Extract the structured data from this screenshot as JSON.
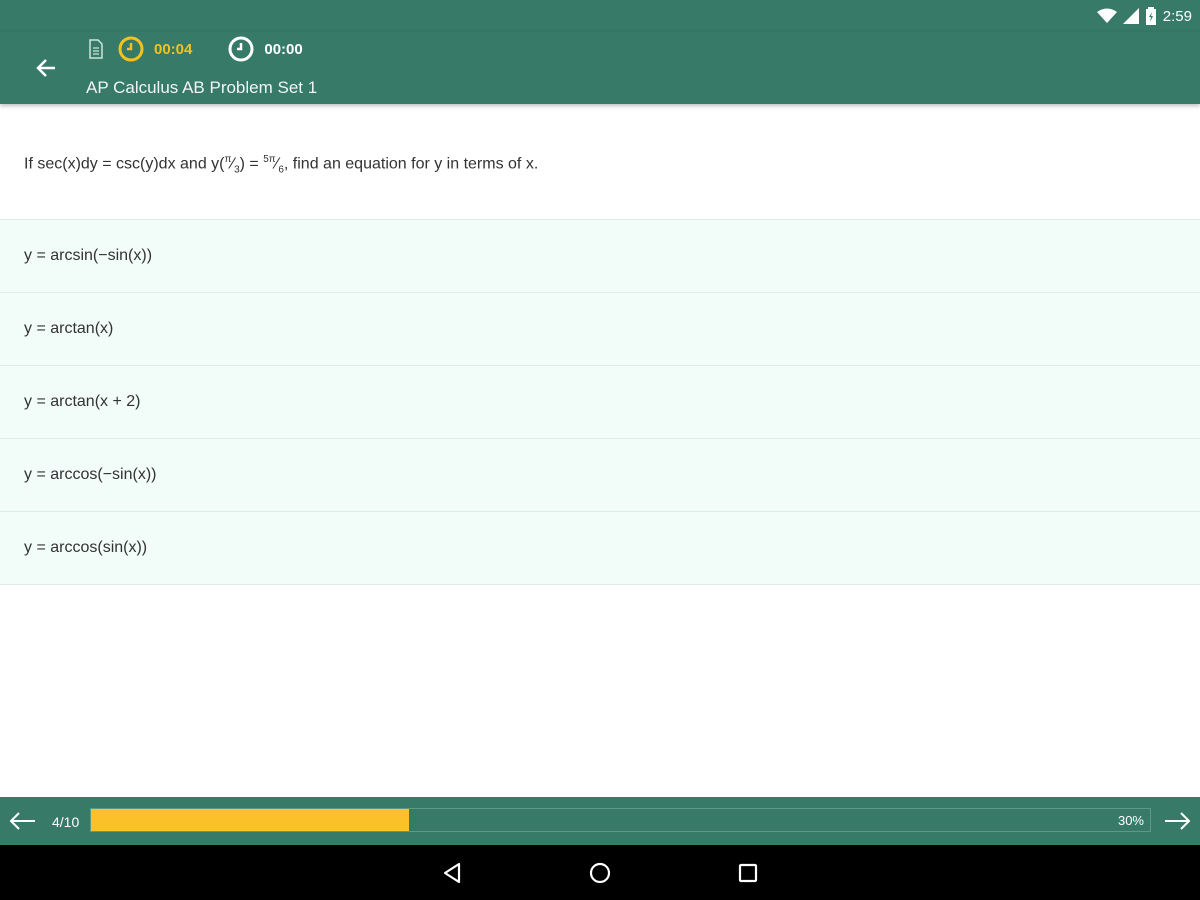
{
  "status_bar": {
    "time": "2:59",
    "icons": [
      "wifi-icon",
      "cell-signal-icon",
      "battery-icon"
    ]
  },
  "app_bar": {
    "title": "AP Calculus AB Problem Set 1",
    "question_timer": "00:04",
    "total_timer": "00:00",
    "colors": {
      "bar": "#367a67",
      "active_timer": "#f2c320"
    }
  },
  "question": {
    "prefix": "If sec(x)dy = csc(y)dx and y(",
    "arg_num": "π",
    "arg_den": "3",
    "equals": ") = ",
    "val_num": "5π",
    "val_den": "6",
    "suffix": ", find an equation for y in terms of x."
  },
  "answers": [
    {
      "text": "y = arcsin(−sin(x))"
    },
    {
      "text": "y = arctan(x)"
    },
    {
      "text": "y = arctan(x + 2)"
    },
    {
      "text": "y = arccos(−sin(x))"
    },
    {
      "text": "y = arccos(sin(x))"
    }
  ],
  "progress": {
    "page_label": "4/10",
    "percent_label": "30%",
    "fraction": 0.3,
    "fill_color": "#fcc12a"
  }
}
